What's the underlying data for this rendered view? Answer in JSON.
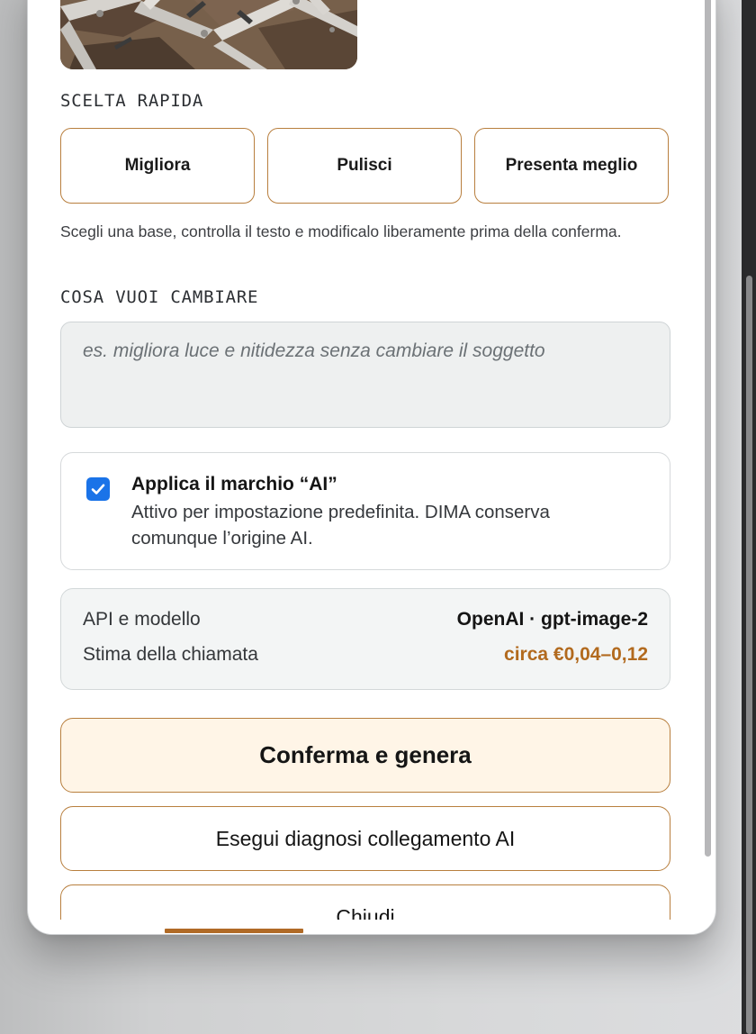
{
  "quick_choice": {
    "label": "SCELTA RAPIDA",
    "options": [
      "Migliora",
      "Pulisci",
      "Presenta meglio"
    ],
    "helper": "Scegli una base, controlla il testo e modificalo liberamente prima della conferma."
  },
  "change": {
    "label": "COSA VUOI CAMBIARE",
    "placeholder": "es. migliora luce e nitidezza senza cambiare il soggetto",
    "value": ""
  },
  "watermark": {
    "checked": true,
    "title": "Applica il marchio “AI”",
    "description": "Attivo per impostazione predefinita. DIMA conserva comunque l’origine AI."
  },
  "info": {
    "api_label": "API e modello",
    "api_value": "OpenAI · gpt-image-2",
    "estimate_label": "Stima della chiamata",
    "estimate_value": "circa €0,04–0,12"
  },
  "actions": {
    "confirm": "Conferma e genera",
    "diagnose": "Esegui diagnosi collegamento AI",
    "close": "Chiudi"
  },
  "colors": {
    "accent": "#b87f3e",
    "accent_text": "#b26a1e",
    "primary_button_bg": "#fff5e7",
    "checkbox": "#1a73e8"
  },
  "icons": {
    "checkbox": "check-icon"
  }
}
